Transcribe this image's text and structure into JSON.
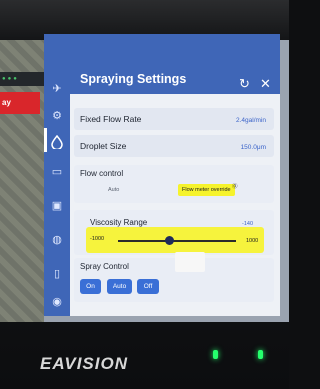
{
  "map": {
    "tag": "ay"
  },
  "panel": {
    "title": "Spraying Settings",
    "refresh_icon": "refresh-icon",
    "close_icon": "close-icon"
  },
  "rows": [
    {
      "label": "Fixed Flow Rate",
      "value": "2.4gal/min"
    },
    {
      "label": "Droplet Size",
      "value": "150.0μm"
    }
  ],
  "flow_control": {
    "title": "Flow control",
    "options": [
      "Auto",
      "Flow meter override"
    ],
    "selected": "Flow meter override"
  },
  "viscosity": {
    "label": "Viscosity Range",
    "current": "-140",
    "min": "-1000",
    "max": "1000",
    "level": 0.43
  },
  "spray_control": {
    "title": "Spray Control",
    "buttons": [
      "On",
      "Auto",
      "Off"
    ]
  },
  "footer": {
    "brand": "EAVISION"
  },
  "colors": {
    "accent": "#3f66b7",
    "highlight": "#f6f32c",
    "button": "#3a6fd6"
  }
}
